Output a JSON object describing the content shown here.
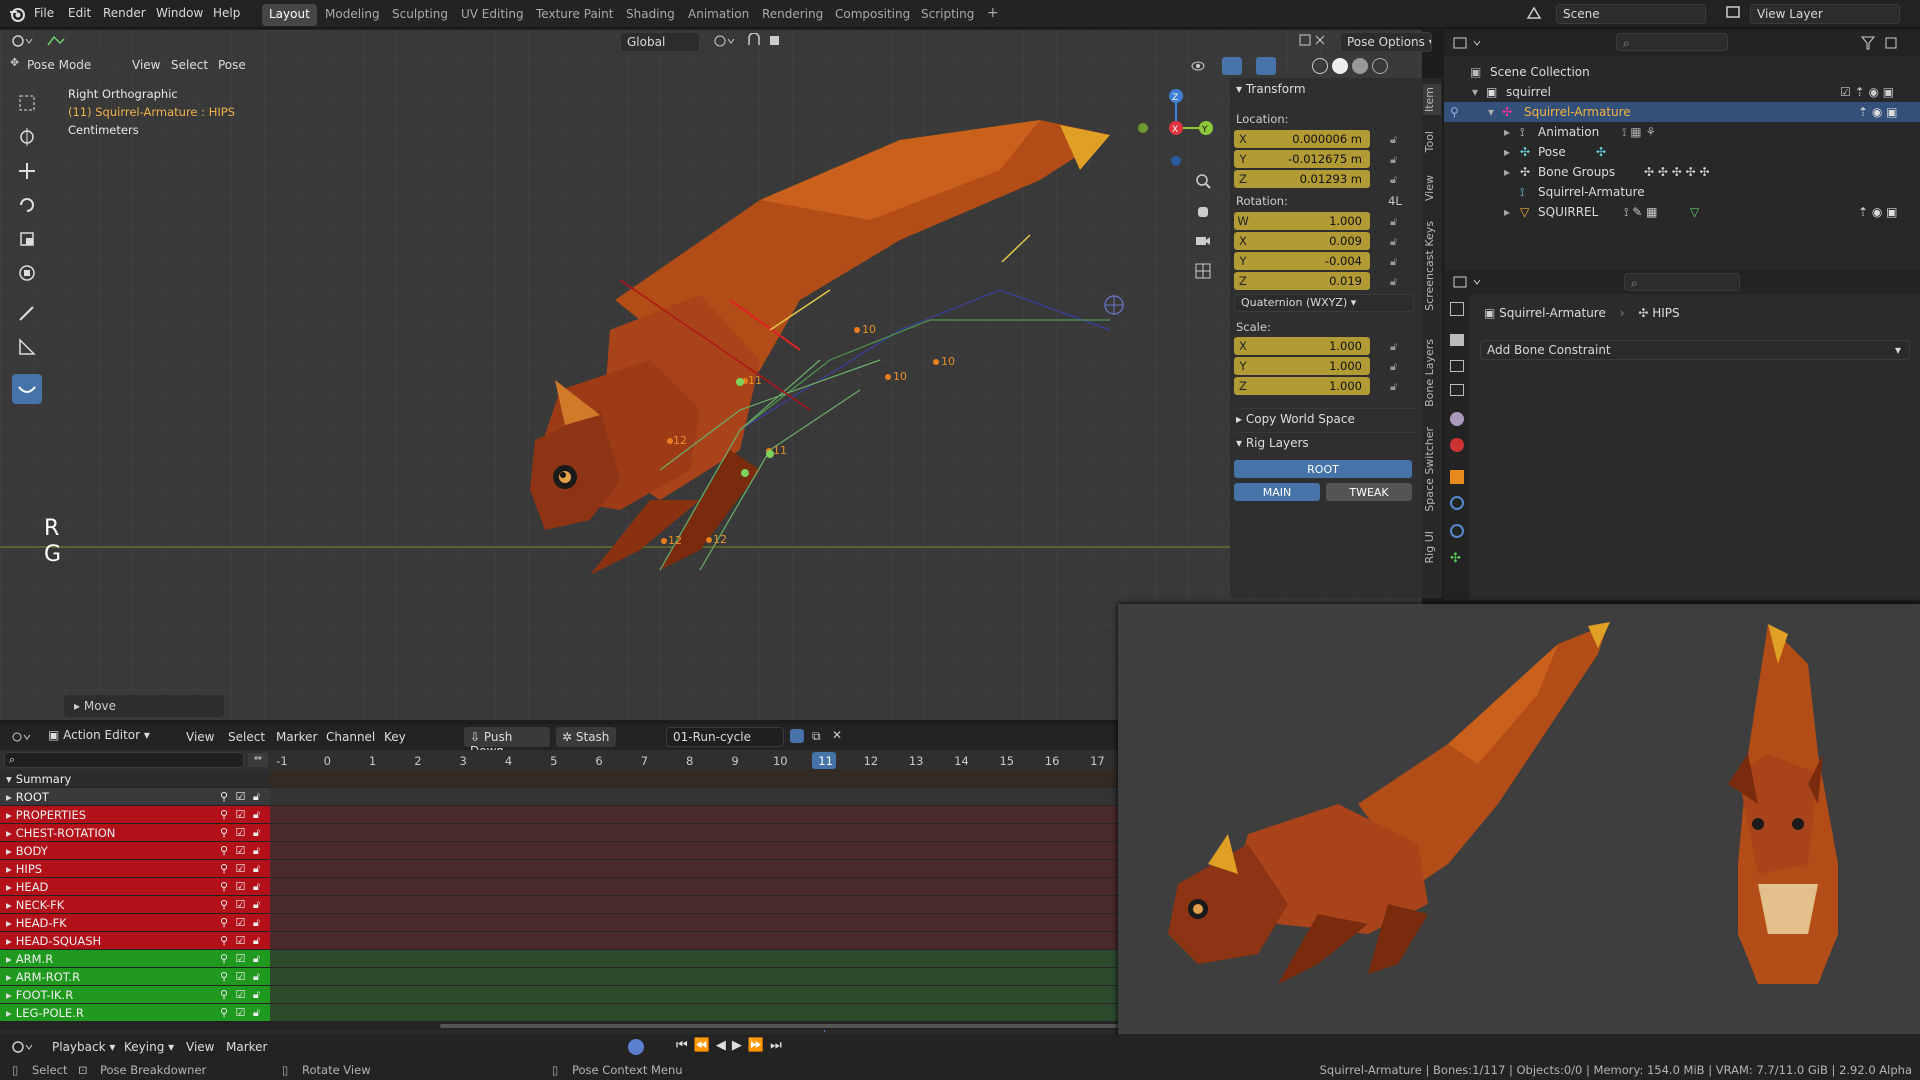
{
  "top_menu": {
    "items": [
      "File",
      "Edit",
      "Render",
      "Window",
      "Help"
    ],
    "workspaces": [
      "Layout",
      "Modeling",
      "Sculpting",
      "UV Editing",
      "Texture Paint",
      "Shading",
      "Animation",
      "Rendering",
      "Compositing",
      "Scripting"
    ],
    "active_workspace": "Layout",
    "add_tab": "+",
    "scene": "Scene",
    "view_layer": "View Layer"
  },
  "viewport": {
    "mode": "Pose Mode",
    "menus": [
      "View",
      "Select",
      "Pose"
    ],
    "orientation": "Global",
    "pose_options": "Pose Options",
    "overlay_title": "Right Orthographic",
    "overlay_object": "(11) Squirrel-Armature : HIPS",
    "overlay_units": "Centimeters",
    "key_r": "R",
    "key_g": "G",
    "last_op": "Move",
    "path_labels": [
      "10",
      "10",
      "10",
      "11",
      "12",
      "11",
      "12",
      "12"
    ],
    "gizmo": {
      "x": "X",
      "y": "Y",
      "z": "Z"
    }
  },
  "npanel": {
    "tabs": [
      "Item",
      "Tool",
      "View",
      "Screencast Keys",
      "Bone Layers",
      "Space Switcher",
      "Rig UI"
    ],
    "transform_title": "Transform",
    "location_label": "Location:",
    "location": [
      {
        "axis": "X",
        "value": "0.000006 m"
      },
      {
        "axis": "Y",
        "value": "-0.012675 m"
      },
      {
        "axis": "Z",
        "value": "0.01293 m"
      }
    ],
    "rotation_label": "Rotation:",
    "rotation_mode_short": "4L",
    "rotation": [
      {
        "axis": "W",
        "value": "1.000"
      },
      {
        "axis": "X",
        "value": "0.009"
      },
      {
        "axis": "Y",
        "value": "-0.004"
      },
      {
        "axis": "Z",
        "value": "0.019"
      }
    ],
    "rotation_mode": "Quaternion (WXYZ)",
    "scale_label": "Scale:",
    "scale": [
      {
        "axis": "X",
        "value": "1.000"
      },
      {
        "axis": "Y",
        "value": "1.000"
      },
      {
        "axis": "Z",
        "value": "1.000"
      }
    ],
    "copy_world_space": "Copy World Space",
    "rig_layers": "Rig Layers",
    "rig_buttons": {
      "root": "ROOT",
      "main": "MAIN",
      "tweak": "TWEAK"
    },
    "colors": {
      "field": "#b29a35",
      "rig_active": "#4673a8"
    }
  },
  "outliner": {
    "title": "Scene Collection",
    "rows": [
      {
        "label": "squirrel",
        "depth": 1
      },
      {
        "label": "Squirrel-Armature",
        "depth": 2,
        "selected": true
      },
      {
        "label": "Animation",
        "depth": 3
      },
      {
        "label": "Pose",
        "depth": 3
      },
      {
        "label": "Bone Groups",
        "depth": 3
      },
      {
        "label": "Squirrel-Armature",
        "depth": 3
      },
      {
        "label": "SQUIRREL",
        "depth": 3
      }
    ]
  },
  "properties": {
    "object": "Squirrel-Armature",
    "bone": "HIPS",
    "add_constraint": "Add Bone Constraint"
  },
  "action_editor": {
    "editor": "Action Editor",
    "menus": [
      "View",
      "Select",
      "Marker",
      "Channel",
      "Key"
    ],
    "push_down": "Push Down",
    "stash": "Stash",
    "action_name": "01-Run-cycle",
    "frames": [
      "-1",
      "0",
      "1",
      "2",
      "3",
      "4",
      "5",
      "6",
      "7",
      "8",
      "9",
      "10",
      "11",
      "12",
      "13",
      "14",
      "15",
      "16",
      "17"
    ],
    "current_frame": "11",
    "summary": "Summary",
    "channels": [
      {
        "name": "ROOT",
        "color": "#3a3a3a"
      },
      {
        "name": "PROPERTIES",
        "color": "#b3101a"
      },
      {
        "name": "CHEST-ROTATION",
        "color": "#b3101a"
      },
      {
        "name": "BODY",
        "color": "#b3101a"
      },
      {
        "name": "HIPS",
        "color": "#b3101a"
      },
      {
        "name": "HEAD",
        "color": "#b3101a"
      },
      {
        "name": "NECK-FK",
        "color": "#b3101a"
      },
      {
        "name": "HEAD-FK",
        "color": "#b3101a"
      },
      {
        "name": "HEAD-SQUASH",
        "color": "#b3101a"
      },
      {
        "name": "ARM.R",
        "color": "#1f9a1f"
      },
      {
        "name": "ARM-ROT.R",
        "color": "#1f9a1f"
      },
      {
        "name": "FOOT-IK.R",
        "color": "#1f9a1f"
      },
      {
        "name": "LEG-POLE.R",
        "color": "#1f9a1f"
      }
    ]
  },
  "timeline": {
    "menus": [
      "Playback",
      "Keying",
      "View",
      "Marker"
    ]
  },
  "statusbar": {
    "select": "Select",
    "breakdown": "Pose Breakdowner",
    "rotate": "Rotate View",
    "context": "Pose Context Menu",
    "info": "Squirrel-Armature | Bones:1/117 | Objects:0/0 | Memory: 154.0 MiB | VRAM: 7.7/11.0 GiB | 2.92.0 Alpha"
  }
}
